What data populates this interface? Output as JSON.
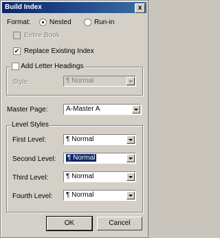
{
  "window": {
    "title": "Build Index",
    "close_symbol": "x"
  },
  "format": {
    "label": "Format:",
    "options": [
      "Nested",
      "Run-in"
    ],
    "selected": "Nested"
  },
  "checkboxes": {
    "entire_book": {
      "label": "Entire Book",
      "checked": false,
      "enabled": false
    },
    "replace_existing": {
      "label": "Replace Existing Index",
      "checked": true,
      "enabled": true
    },
    "add_letter_headings": {
      "label": "Add Letter Headings",
      "checked": false,
      "enabled": true
    }
  },
  "style_select": {
    "label": "Style:",
    "value": "¶ Normal",
    "enabled": false
  },
  "master_page": {
    "label": "Master Page:",
    "value": "A-Master A"
  },
  "level_styles": {
    "legend": "Level Styles",
    "first": {
      "label": "First Level:",
      "value": "¶ Normal"
    },
    "second": {
      "label": "Second Level:",
      "value": "¶ Normal"
    },
    "third": {
      "label": "Third Level:",
      "value": "¶ Normal"
    },
    "fourth": {
      "label": "Fourth Level:",
      "value": "¶ Normal"
    }
  },
  "buttons": {
    "ok": "OK",
    "cancel": "Cancel"
  },
  "colors": {
    "titlebar": "#0a246a",
    "face": "#d4d0c8"
  }
}
